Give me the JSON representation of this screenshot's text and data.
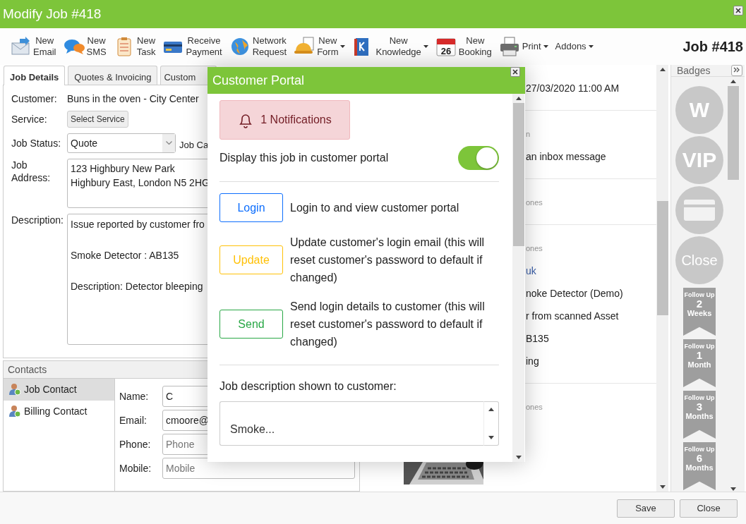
{
  "window": {
    "title": "Modify Job #418",
    "job_number": "Job #418"
  },
  "toolbar": [
    {
      "label": "New Email",
      "has_menu": false
    },
    {
      "label": "New SMS",
      "has_menu": false
    },
    {
      "label": "New Task",
      "has_menu": false
    },
    {
      "label": "Receive Payment",
      "has_menu": false
    },
    {
      "label": "Network Request",
      "has_menu": false
    },
    {
      "label": "New Form",
      "has_menu": true
    },
    {
      "label": "New Knowledge",
      "has_menu": true
    },
    {
      "label": "New Booking",
      "has_menu": false,
      "icon_text": "26"
    },
    {
      "label": "Print",
      "has_menu": true
    },
    {
      "label": "Addons",
      "has_menu": true
    }
  ],
  "tabs": [
    {
      "label": "Job Details",
      "selected": true
    },
    {
      "label": "Quotes & Invoicing",
      "selected": false
    },
    {
      "label": "Custom",
      "selected": false
    }
  ],
  "job_form": {
    "customer_label": "Customer:",
    "customer": "Buns in the oven - City Center",
    "service_label": "Service:",
    "service_button": "Select Service",
    "status_label": "Job Status:",
    "status": "Quote",
    "category_label": "Job Ca",
    "address_label": "Job Address:",
    "address": "123 Highbury New Park\nHighbury East, London N5 2HG",
    "description_label": "Description:",
    "description": "Issue reported by customer fro\n\nSmoke Detector : AB135\n\nDescription: Detector bleeping"
  },
  "contacts": {
    "title": "Contacts",
    "list": [
      {
        "label": "Job Contact",
        "selected": true
      },
      {
        "label": "Billing Contact",
        "selected": false
      }
    ],
    "fields": [
      {
        "label": "Name:",
        "value": "C"
      },
      {
        "label": "Email:",
        "value": "cmoore@"
      },
      {
        "label": "Phone:",
        "placeholder": "Phone"
      },
      {
        "label": "Mobile:",
        "placeholder": "Mobile"
      }
    ]
  },
  "activity": [
    {
      "lines": [
        {
          "kind": "text",
          "text": "27/03/2020 11:00 AM"
        }
      ]
    },
    {
      "lines": [
        {
          "kind": "meta",
          "text": "n"
        },
        {
          "kind": "text",
          "text": "an inbox message"
        }
      ]
    },
    {
      "lines": [
        {
          "kind": "meta",
          "text": "ones"
        }
      ]
    },
    {
      "lines": [
        {
          "kind": "meta",
          "text": "ones"
        },
        {
          "kind": "link",
          "text": "uk"
        },
        {
          "kind": "text",
          "text": "noke Detector (Demo)"
        },
        {
          "kind": "text",
          "text": "r from scanned Asset"
        },
        {
          "kind": "text",
          "text": "B135"
        },
        {
          "kind": "text",
          "text": "ing"
        }
      ]
    },
    {
      "lines": [
        {
          "kind": "meta",
          "text": "ones"
        },
        {
          "kind": "picture"
        }
      ]
    }
  ],
  "badges": {
    "title": "Badges",
    "items": [
      {
        "kind": "circle",
        "text": "W"
      },
      {
        "kind": "circle",
        "text": "VIP"
      },
      {
        "kind": "card"
      },
      {
        "kind": "stamp",
        "text": "Close"
      },
      {
        "kind": "ribbon",
        "top": "Follow Up",
        "number": "2",
        "unit": "Weeks"
      },
      {
        "kind": "ribbon",
        "top": "Follow Up",
        "number": "1",
        "unit": "Month"
      },
      {
        "kind": "ribbon",
        "top": "Follow Up",
        "number": "3",
        "unit": "Months"
      },
      {
        "kind": "ribbon",
        "top": "Follow Up",
        "number": "6",
        "unit": "Months"
      }
    ]
  },
  "footer": {
    "buttons": [
      "Save",
      "Close"
    ]
  },
  "portal": {
    "title": "Customer Portal",
    "notifications": "1 Notifications",
    "display_label": "Display this job in customer portal",
    "display_on": true,
    "actions": [
      {
        "button": "Login",
        "kind": "primary",
        "text": "Login to and view customer portal"
      },
      {
        "button": "Update",
        "kind": "warning",
        "text": "Update customer's login email (this will reset customer's password to default if changed)"
      },
      {
        "button": "Send",
        "kind": "success",
        "text": "Send login details to customer (this will reset customer's password to default if changed)"
      }
    ],
    "description_label": "Job description shown to customer:",
    "description": "Smoke..."
  }
}
